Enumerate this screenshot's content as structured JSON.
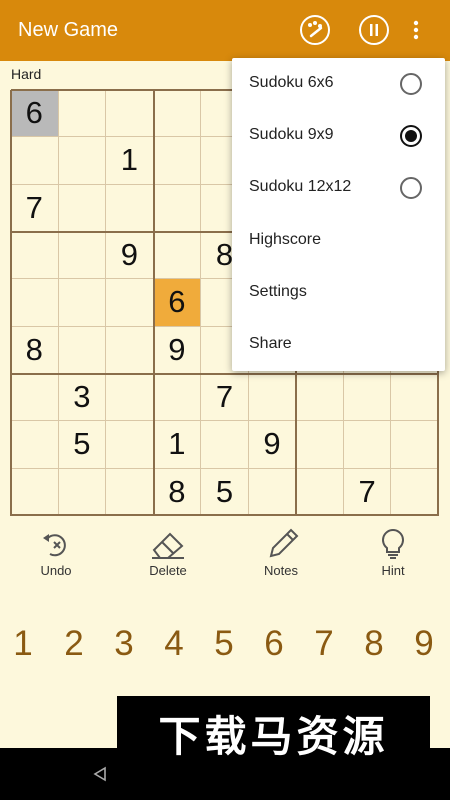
{
  "app_bar": {
    "title": "New Game",
    "icons": [
      "palette-icon",
      "pause-icon",
      "more-vert-icon"
    ]
  },
  "game": {
    "difficulty": "Hard",
    "grid": [
      [
        "6",
        "",
        "",
        "",
        "",
        "",
        "",
        "",
        ""
      ],
      [
        "",
        "",
        "1",
        "",
        "",
        "",
        "",
        "",
        ""
      ],
      [
        "7",
        "",
        "",
        "",
        "",
        "",
        "",
        "",
        ""
      ],
      [
        "",
        "",
        "9",
        "",
        "8",
        "",
        "",
        "",
        ""
      ],
      [
        "",
        "",
        "",
        "6",
        "",
        "",
        "",
        "",
        ""
      ],
      [
        "8",
        "",
        "",
        "9",
        "",
        "",
        "",
        "",
        ""
      ],
      [
        "",
        "3",
        "",
        "",
        "7",
        "",
        "",
        "",
        ""
      ],
      [
        "",
        "5",
        "",
        "1",
        "",
        "9",
        "",
        "",
        ""
      ],
      [
        "",
        "",
        "",
        "8",
        "5",
        "",
        "",
        "7",
        ""
      ]
    ],
    "selected_cell": {
      "row": 0,
      "col": 0
    },
    "highlighted_cell": {
      "row": 4,
      "col": 3
    }
  },
  "tools": [
    {
      "label": "Undo",
      "icon": "undo-icon"
    },
    {
      "label": "Delete",
      "icon": "eraser-icon"
    },
    {
      "label": "Notes",
      "icon": "pencil-icon"
    },
    {
      "label": "Hint",
      "icon": "lightbulb-icon"
    }
  ],
  "numpad": [
    "1",
    "2",
    "3",
    "4",
    "5",
    "6",
    "7",
    "8",
    "9"
  ],
  "menu": {
    "items": [
      {
        "label": "Sudoku 6x6",
        "type": "radio",
        "selected": false
      },
      {
        "label": "Sudoku 9x9",
        "type": "radio",
        "selected": true
      },
      {
        "label": "Sudoku 12x12",
        "type": "radio",
        "selected": false
      },
      {
        "label": "Highscore",
        "type": "action"
      },
      {
        "label": "Settings",
        "type": "action"
      },
      {
        "label": "Share",
        "type": "action"
      }
    ]
  },
  "watermark": {
    "text": "下载马资源"
  },
  "colors": {
    "app_bar": "#d8890c",
    "background": "#fdf8dc",
    "selected": "#b9b9b9",
    "highlight": "#f0ab3b",
    "numbers": "#8a5a12"
  }
}
